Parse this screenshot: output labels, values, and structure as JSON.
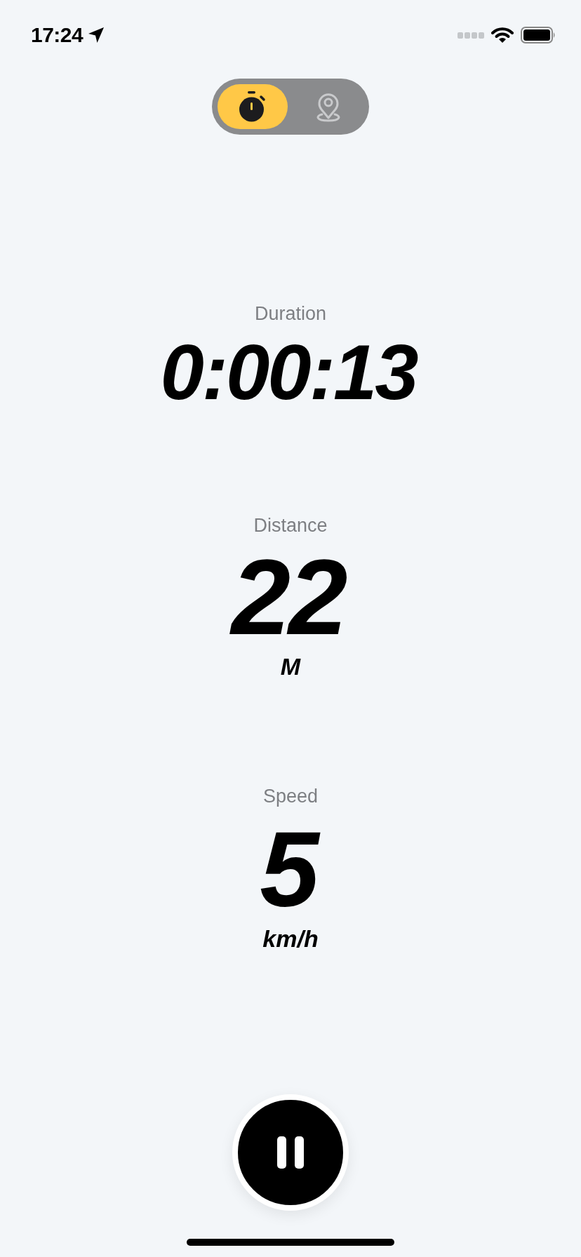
{
  "status_bar": {
    "time": "17:24"
  },
  "mode_toggle": [
    {
      "kind": "timer",
      "selected": true
    },
    {
      "kind": "map",
      "selected": false
    }
  ],
  "stats": [
    {
      "kind": "duration",
      "label": "Duration",
      "value": "0:00:13"
    },
    {
      "kind": "distance",
      "label": "Distance",
      "value": "22",
      "unit": "M"
    },
    {
      "kind": "speed",
      "label": "Speed",
      "value": "5",
      "unit": "km/h"
    }
  ],
  "pause_button": {
    "kind": "pause"
  }
}
